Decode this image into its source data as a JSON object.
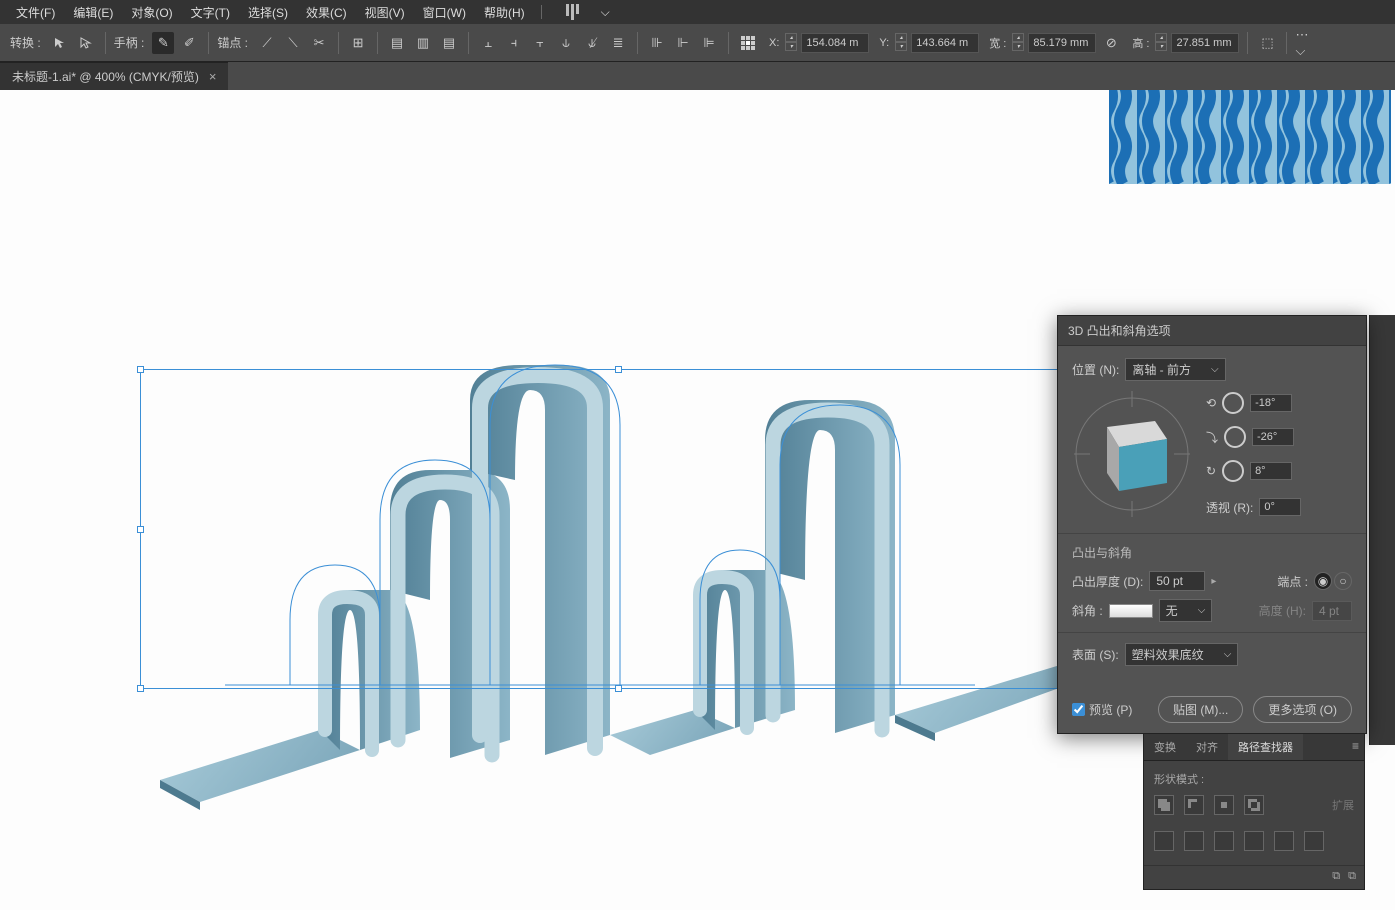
{
  "menu": {
    "file": "文件(F)",
    "edit": "编辑(E)",
    "object": "对象(O)",
    "text": "文字(T)",
    "select": "选择(S)",
    "effect": "效果(C)",
    "view": "视图(V)",
    "window": "窗口(W)",
    "help": "帮助(H)"
  },
  "toolbar": {
    "transform": "转换 :",
    "handle": "手柄 :",
    "anchor": "锚点 :",
    "x_label": "X:",
    "y_label": "Y:",
    "w_label": "宽 :",
    "h_label": "高 :",
    "x_value": "154.084 m",
    "y_value": "143.664 m",
    "w_value": "85.179 mm",
    "h_value": "27.851 mm"
  },
  "doc_tab": {
    "title": "未标题-1.ai* @ 400% (CMYK/预览)"
  },
  "dialog": {
    "title": "3D 凸出和斜角选项",
    "position_label": "位置 (N):",
    "position_value": "离轴 - 前方",
    "rot_x": "-18°",
    "rot_y": "-26°",
    "rot_z": "8°",
    "perspective_label": "透视 (R):",
    "perspective_value": "0°",
    "extrude_section": "凸出与斜角",
    "depth_label": "凸出厚度 (D):",
    "depth_value": "50 pt",
    "cap_label": "端点 :",
    "bevel_label": "斜角 :",
    "bevel_value": "无",
    "height_label": "高度 (H):",
    "height_value": "4 pt",
    "surface_label": "表面 (S):",
    "surface_value": "塑料效果底纹",
    "preview_label": "预览 (P)",
    "map_btn": "贴图 (M)...",
    "more_btn": "更多选项 (O)"
  },
  "pathfinder": {
    "tab_transform": "变换",
    "tab_align": "对齐",
    "tab_pathfinder": "路径查找器",
    "shape_mode": "形状模式 :",
    "expand": "扩展"
  }
}
